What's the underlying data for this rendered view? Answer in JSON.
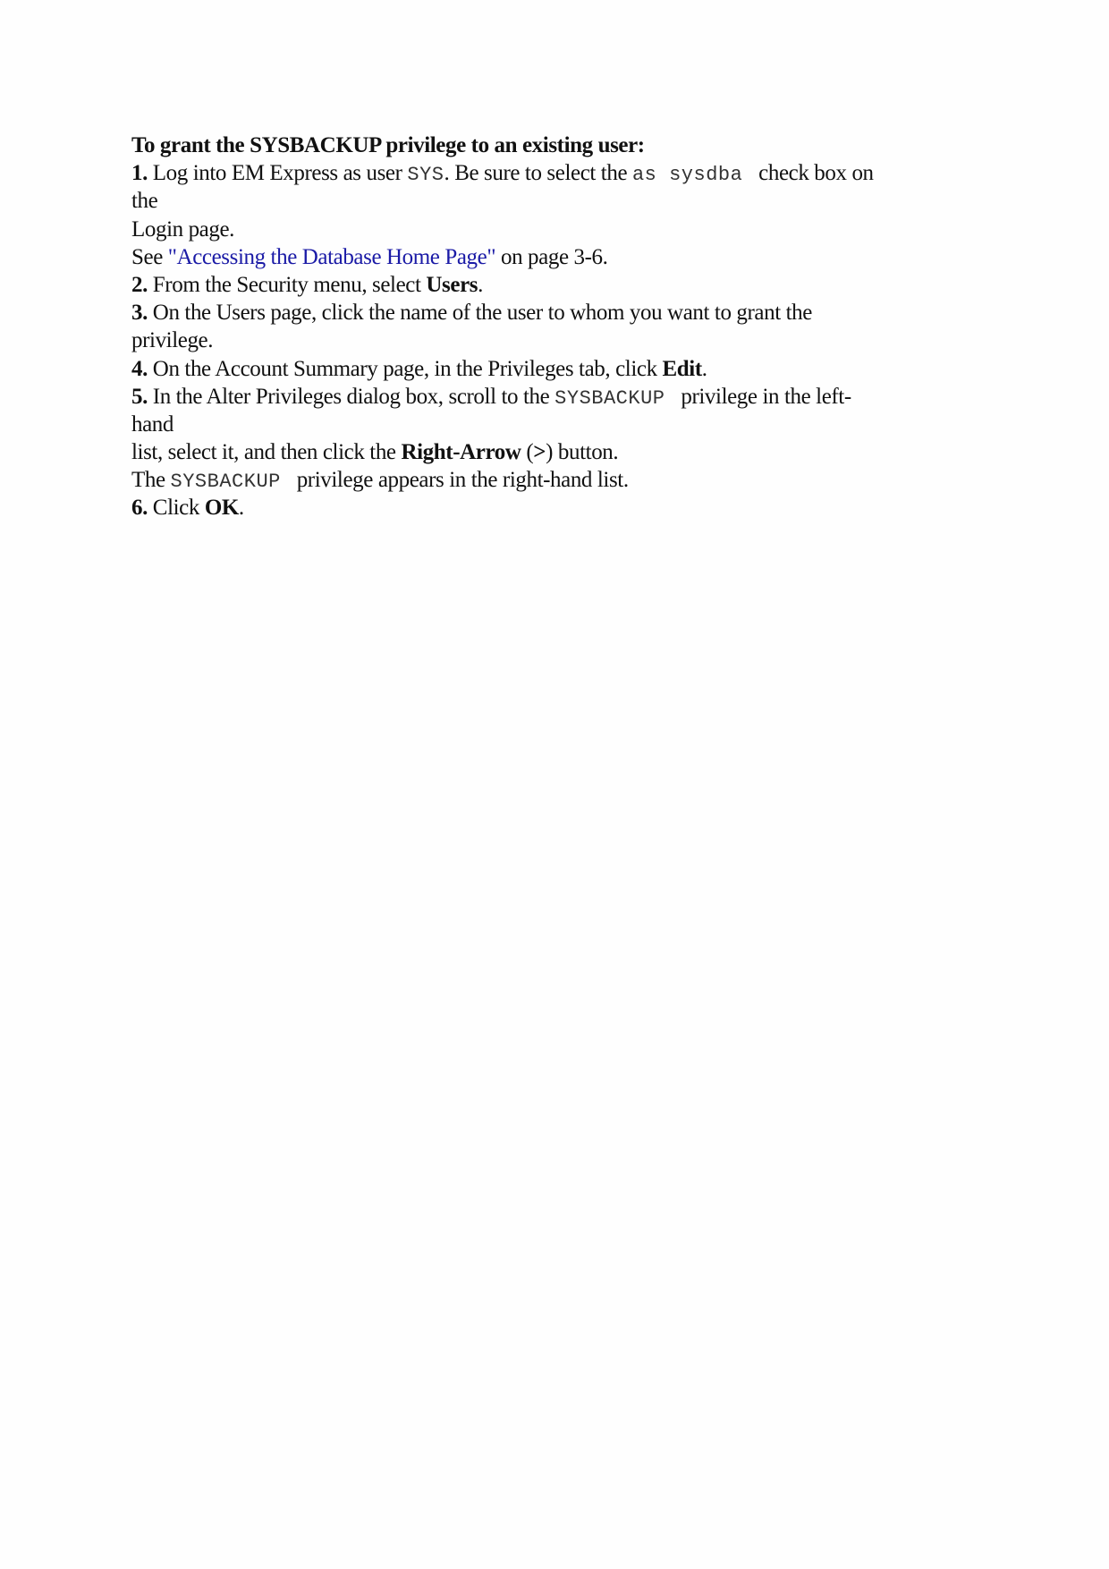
{
  "document": {
    "heading": "To grant the SYSBACKUP privilege to an existing user:",
    "link_color": "#1a1aa6",
    "steps": {
      "s1": {
        "num": "1.",
        "t1": " Log into EM Express as user ",
        "code1": "SYS",
        "t2": ". Be sure to select the ",
        "code2": "as sysdba",
        "t3": " check box on",
        "t4": "the",
        "t5": "Login page."
      },
      "see": {
        "t1": "See ",
        "link": "\"Accessing the Database Home Page\"",
        "t2": " on page 3-6."
      },
      "s2": {
        "num": "2.",
        "t1": " From the Security menu, select ",
        "bold": "Users",
        "t2": "."
      },
      "s3": {
        "num": "3.",
        "t1": " On the Users page, click the name of the user to whom you want to grant the",
        "t2": "privilege."
      },
      "s4": {
        "num": "4.",
        "t1": " On the Account Summary page, in the Privileges tab, click ",
        "bold": "Edit",
        "t2": "."
      },
      "s5": {
        "num": "5.",
        "t1": " In the Alter Privileges dialog box, scroll to the ",
        "code": "SYSBACKUP",
        "t2": " privilege in the left-",
        "t3": "hand",
        "t4": "list, select it, and then click the ",
        "bold1": "Right-Arrow",
        "t5": " (",
        "bold2": ">",
        "t6": ") button.",
        "t7": "The ",
        "code2": "SYSBACKUP",
        "t8": " privilege appears in the right-hand list."
      },
      "s6": {
        "num": "6.",
        "t1": " Click ",
        "bold": "OK",
        "t2": "."
      }
    }
  }
}
